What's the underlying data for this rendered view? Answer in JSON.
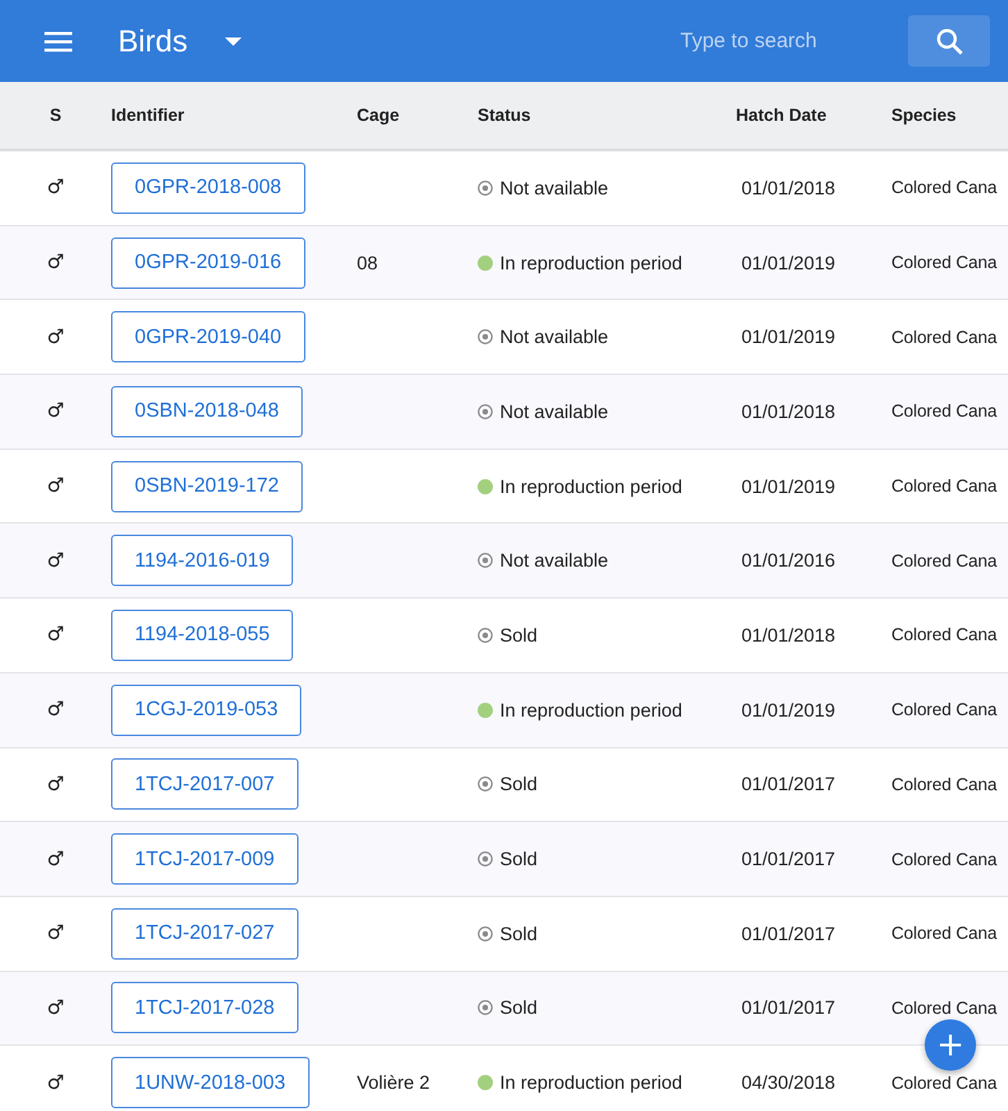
{
  "app_bar": {
    "title": "Birds",
    "search": {
      "placeholder": "Type to search"
    }
  },
  "table": {
    "columns": [
      "S",
      "Identifier",
      "Cage",
      "Status",
      "Hatch Date",
      "Species"
    ],
    "rows": [
      {
        "sex": "♂",
        "identifier": "0GPR-2018-008",
        "cage": "",
        "status": {
          "kind": "inactive",
          "label": "Not available"
        },
        "hatch_date": "01/01/2018",
        "species": "Colored Cana"
      },
      {
        "sex": "♂",
        "identifier": "0GPR-2019-016",
        "cage": "08",
        "status": {
          "kind": "active",
          "label": "In reproduction period"
        },
        "hatch_date": "01/01/2019",
        "species": "Colored Cana"
      },
      {
        "sex": "♂",
        "identifier": "0GPR-2019-040",
        "cage": "",
        "status": {
          "kind": "inactive",
          "label": "Not available"
        },
        "hatch_date": "01/01/2019",
        "species": "Colored Cana"
      },
      {
        "sex": "♂",
        "identifier": "0SBN-2018-048",
        "cage": "",
        "status": {
          "kind": "inactive",
          "label": "Not available"
        },
        "hatch_date": "01/01/2018",
        "species": "Colored Cana"
      },
      {
        "sex": "♂",
        "identifier": "0SBN-2019-172",
        "cage": "",
        "status": {
          "kind": "active",
          "label": "In reproduction period"
        },
        "hatch_date": "01/01/2019",
        "species": "Colored Cana"
      },
      {
        "sex": "♂",
        "identifier": "1194-2016-019",
        "cage": "",
        "status": {
          "kind": "inactive",
          "label": "Not available"
        },
        "hatch_date": "01/01/2016",
        "species": "Colored Cana"
      },
      {
        "sex": "♂",
        "identifier": "1194-2018-055",
        "cage": "",
        "status": {
          "kind": "inactive",
          "label": "Sold"
        },
        "hatch_date": "01/01/2018",
        "species": "Colored Cana"
      },
      {
        "sex": "♂",
        "identifier": "1CGJ-2019-053",
        "cage": "",
        "status": {
          "kind": "active",
          "label": "In reproduction period"
        },
        "hatch_date": "01/01/2019",
        "species": "Colored Cana"
      },
      {
        "sex": "♂",
        "identifier": "1TCJ-2017-007",
        "cage": "",
        "status": {
          "kind": "inactive",
          "label": "Sold"
        },
        "hatch_date": "01/01/2017",
        "species": "Colored Cana"
      },
      {
        "sex": "♂",
        "identifier": "1TCJ-2017-009",
        "cage": "",
        "status": {
          "kind": "inactive",
          "label": "Sold"
        },
        "hatch_date": "01/01/2017",
        "species": "Colored Cana"
      },
      {
        "sex": "♂",
        "identifier": "1TCJ-2017-027",
        "cage": "",
        "status": {
          "kind": "inactive",
          "label": "Sold"
        },
        "hatch_date": "01/01/2017",
        "species": "Colored Cana"
      },
      {
        "sex": "♂",
        "identifier": "1TCJ-2017-028",
        "cage": "",
        "status": {
          "kind": "inactive",
          "label": "Sold"
        },
        "hatch_date": "01/01/2017",
        "species": "Colored Cana"
      },
      {
        "sex": "♂",
        "identifier": "1UNW-2018-003",
        "cage": "Volière 2",
        "status": {
          "kind": "active",
          "label": "In reproduction period"
        },
        "hatch_date": "04/30/2018",
        "species": "Colored Cana"
      }
    ]
  },
  "fab": {
    "label": "+"
  }
}
